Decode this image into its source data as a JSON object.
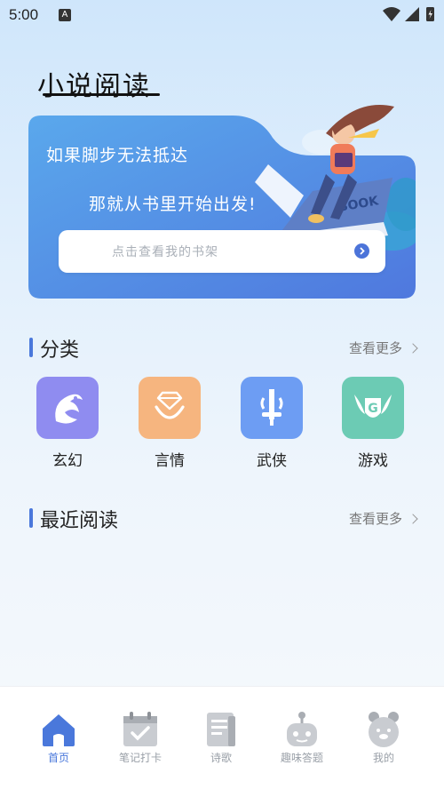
{
  "status_bar": {
    "time": "5:00",
    "notification_letter": "A"
  },
  "app": {
    "title": "小说阅读"
  },
  "banner": {
    "line1": "如果脚步无法抵达",
    "line2": "那就从书里开始出发!",
    "search_placeholder": "点击查看我的书架",
    "book_text": "BOOK"
  },
  "categories": {
    "title": "分类",
    "more": "查看更多",
    "items": [
      {
        "label": "玄幻",
        "color": "#8f8cf0"
      },
      {
        "label": "言情",
        "color": "#f6b57f"
      },
      {
        "label": "武侠",
        "color": "#6d9df3"
      },
      {
        "label": "游戏",
        "color": "#6ccbb4"
      }
    ]
  },
  "recent": {
    "title": "最近阅读",
    "more": "查看更多"
  },
  "tabs": [
    {
      "label": "首页",
      "icon": "home-icon",
      "active": true
    },
    {
      "label": "笔记打卡",
      "icon": "calendar-check-icon",
      "active": false
    },
    {
      "label": "诗歌",
      "icon": "document-icon",
      "active": false
    },
    {
      "label": "趣味答题",
      "icon": "robot-icon",
      "active": false
    },
    {
      "label": "我的",
      "icon": "bear-face-icon",
      "active": false
    }
  ],
  "colors": {
    "accent": "#4a78db",
    "banner_start": "#5aa8ec",
    "banner_end": "#4f78de"
  }
}
